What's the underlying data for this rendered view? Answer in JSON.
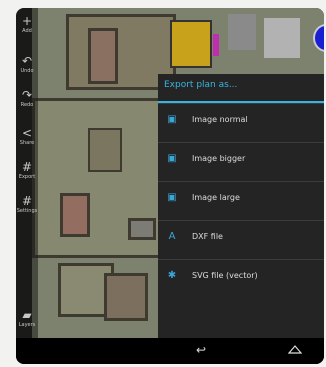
{
  "toolbar": {
    "items": [
      {
        "label": "Add",
        "icon": "plus-icon"
      },
      {
        "label": "Undo",
        "icon": "undo-icon"
      },
      {
        "label": "Redo",
        "icon": "redo-icon"
      },
      {
        "label": "Share",
        "icon": "share-icon"
      },
      {
        "label": "Export",
        "icon": "grid-icon"
      },
      {
        "label": "Settings",
        "icon": "settings-icon"
      },
      {
        "label": "Layers",
        "icon": "layers-icon"
      }
    ]
  },
  "menu": {
    "title": "Export plan as...",
    "items": [
      {
        "label": "Image normal",
        "icon": "image-icon"
      },
      {
        "label": "Image bigger",
        "icon": "image-icon"
      },
      {
        "label": "Image large",
        "icon": "image-icon"
      },
      {
        "label": "DXF file",
        "icon": "dxf-icon"
      },
      {
        "label": "SVG file (vector)",
        "icon": "svg-icon"
      }
    ]
  },
  "colors": {
    "accent": "#38b4e0",
    "menu_bg": "#242424",
    "plan_bg": "#7d826e"
  }
}
